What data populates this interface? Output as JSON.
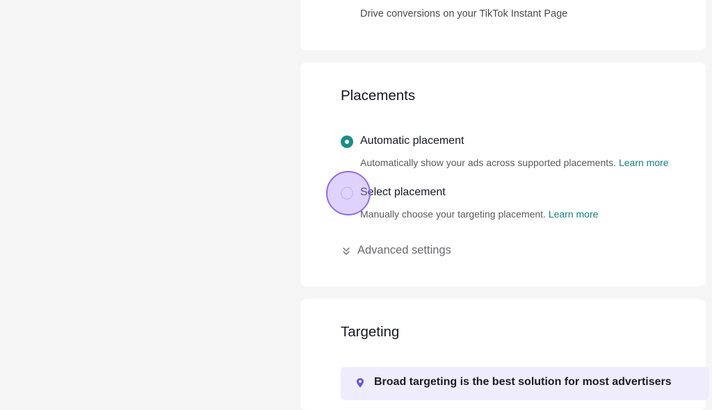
{
  "top_card": {
    "subtext": "Drive conversions on your TikTok Instant Page"
  },
  "placements": {
    "title": "Placements",
    "options": [
      {
        "label": "Automatic placement",
        "description": "Automatically show your ads across supported placements.",
        "learn_more": "Learn more",
        "selected": true
      },
      {
        "label": "Select placement",
        "description": "Manually choose your targeting placement.",
        "learn_more": "Learn more",
        "selected": false
      }
    ],
    "advanced_settings": "Advanced settings"
  },
  "targeting": {
    "title": "Targeting",
    "banner_text": "Broad targeting is the best solution for most advertisers"
  },
  "colors": {
    "accent": "#1a8d89",
    "link": "#12807c",
    "banner_bg": "#efedfb",
    "click_indicator": "#8f6af2"
  },
  "icons": {
    "radio_checked": "radio-checked-icon",
    "radio_unchecked": "radio-unchecked-icon",
    "advanced_toggle": "double-chevron-down-icon",
    "banner": "location-pin-icon"
  }
}
